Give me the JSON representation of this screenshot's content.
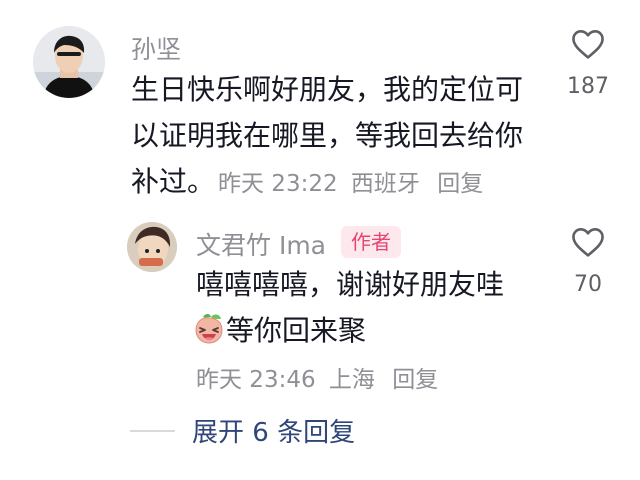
{
  "main_comment": {
    "username": "孙坚",
    "lines": [
      "生日快乐啊好朋友，我的定位可",
      "以证明我在哪里，等我回去给你",
      "补过。"
    ],
    "time": "昨天 23:22",
    "location": "西班牙",
    "reply_label": "回复",
    "likes": "187",
    "icons": {
      "avatar": "avatar",
      "like": "heart-icon"
    }
  },
  "reply_comment": {
    "username": "文君竹 Ima",
    "author_badge": "作者",
    "lines": [
      "嘻嘻嘻嘻，谢谢好朋友哇",
      "等你回来聚"
    ],
    "emoji": "laughing-peach-emoji",
    "time": "昨天 23:46",
    "location": "上海",
    "reply_label": "回复",
    "likes": "70",
    "icons": {
      "avatar": "avatar",
      "like": "heart-icon"
    }
  },
  "expand_replies": "展开 6 条回复",
  "colors": {
    "primary_text": "#161823",
    "secondary_text": "#8f8f96",
    "badge_bg": "#fde8ee",
    "badge_text": "#e74571",
    "link": "#30467a"
  }
}
